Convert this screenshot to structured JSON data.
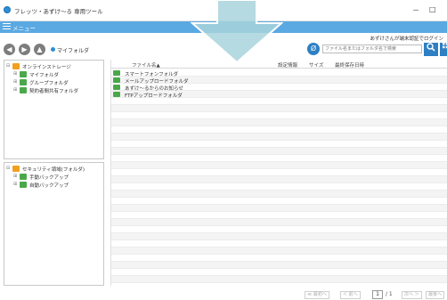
{
  "window": {
    "title": "フレッツ・あずけ～る 専用ツール",
    "minimize": "－",
    "maximize": "□"
  },
  "menubar": {
    "label": "メニュー"
  },
  "login_message": "あずけさんが端末認証でログイン",
  "breadcrumb": {
    "current": "マイフォルダ"
  },
  "search": {
    "placeholder": "ファイル名またはフォルダ名で検索"
  },
  "tree_top": {
    "root": "オンラインストレージ",
    "items": [
      "マイフォルダ",
      "グループフォルダ",
      "契約者間共有フォルダ"
    ]
  },
  "tree_bottom": {
    "root": "セキュリティ領域(フォルダ)",
    "items": [
      "手動バックアップ",
      "自動バックアップ"
    ]
  },
  "file_list": {
    "columns": [
      "ファイル名▲",
      "設定情報",
      "サイズ",
      "最終保存日時"
    ],
    "rows": [
      {
        "name": "スマートフォンフォルダ",
        "color": "#4aa84a"
      },
      {
        "name": "メールアップロードフォルダ",
        "color": "#4aa84a"
      },
      {
        "name": "あずけ～るからのお知らせ",
        "color": "#4aa84a"
      },
      {
        "name": "FTPアップロードフォルダ",
        "color": "#4aa84a"
      }
    ]
  },
  "pager": {
    "first": "≪ 最初へ",
    "prev": "＜ 前へ",
    "current_page": "1",
    "total": "/ 1",
    "next": "次へ ＞",
    "last": "最後へ"
  },
  "colors": {
    "accent": "#5aa9e2",
    "primary_button": "#2e7fc4",
    "folder_green": "#4aa84a",
    "folder_orange": "#f0a020"
  }
}
